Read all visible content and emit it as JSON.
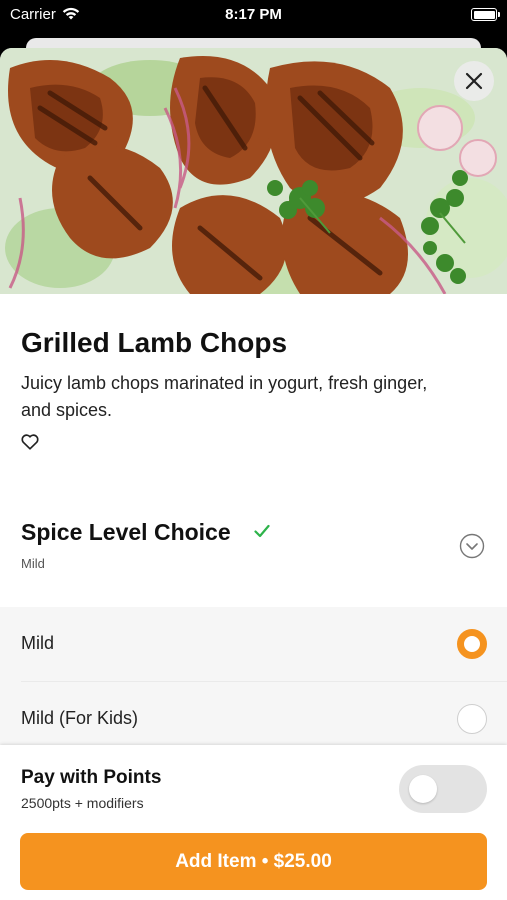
{
  "status_bar": {
    "carrier": "Carrier",
    "time": "8:17 PM"
  },
  "item": {
    "title": "Grilled Lamb Chops",
    "description": "Juicy lamb chops marinated in yogurt, fresh ginger, and spices."
  },
  "modifier_group": {
    "title": "Spice Level Choice",
    "selected_summary": "Mild",
    "options": [
      {
        "label": "Mild",
        "selected": true
      },
      {
        "label": "Mild (For Kids)",
        "selected": false
      }
    ]
  },
  "points": {
    "title": "Pay with Points",
    "subtitle": "2500pts + modifiers",
    "enabled": false
  },
  "add_button": {
    "label": "Add Item • $25.00"
  },
  "colors": {
    "accent": "#f5931f",
    "check": "#2db34a",
    "option_bg": "#f6f6f6"
  }
}
